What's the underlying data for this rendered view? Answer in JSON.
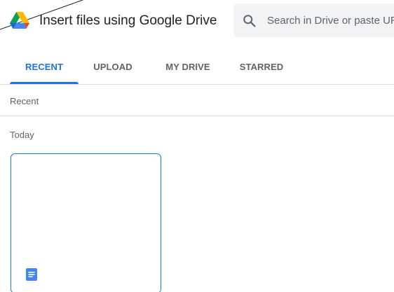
{
  "header": {
    "title": "Insert files using Google Drive",
    "logo_icon": "google-drive-logo",
    "search": {
      "placeholder": "Search in Drive or paste URL",
      "value": "",
      "icon": "search-icon"
    }
  },
  "tabs": [
    {
      "label": "RECENT",
      "active": true
    },
    {
      "label": "UPLOAD",
      "active": false
    },
    {
      "label": "MY DRIVE",
      "active": false
    },
    {
      "label": "STARRED",
      "active": false
    }
  ],
  "breadcrumb": "Recent",
  "sections": [
    {
      "heading": "Today",
      "files": [
        {
          "type_icon": "google-docs-icon",
          "selected": true
        }
      ]
    }
  ],
  "colors": {
    "accent": "#1a73e8",
    "text_secondary": "#5f6368",
    "search_bg": "#f1f3f4",
    "divider": "#dadce0",
    "docs_blue": "#4285f4"
  }
}
